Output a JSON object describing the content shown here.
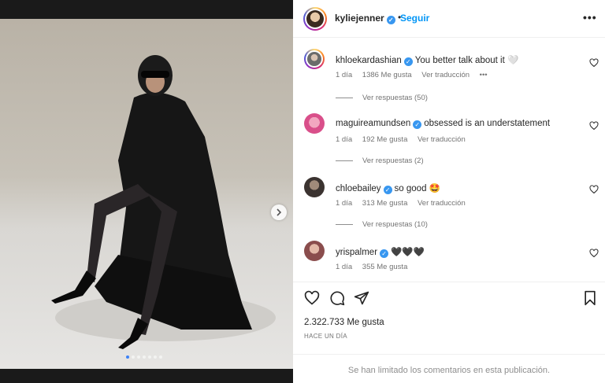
{
  "post": {
    "username": "kyliejenner",
    "follow_label": "Seguir",
    "separator": "•",
    "more_label": "•••",
    "carousel_count": 7,
    "carousel_index": 0
  },
  "comments": [
    {
      "user": "khloekardashian",
      "text": "You better talk about it 🤍",
      "time": "1 día",
      "likes": "1386 Me gusta",
      "translate": "Ver traducción",
      "extra": "•••",
      "replies": "Ver respuestas (50)"
    },
    {
      "user": "maguireamundsen",
      "text": "obsessed is an understatement",
      "time": "1 día",
      "likes": "192 Me gusta",
      "translate": "Ver traducción",
      "replies": "Ver respuestas (2)"
    },
    {
      "user": "chloebailey",
      "text": "so good 🤩",
      "time": "1 día",
      "likes": "313 Me gusta",
      "translate": "Ver traducción",
      "replies": "Ver respuestas (10)"
    },
    {
      "user": "yrispalmer",
      "text": "🖤🖤🖤",
      "time": "1 día",
      "likes": "355 Me gusta"
    }
  ],
  "stats": {
    "likes": "2.322.733 Me gusta",
    "date": "HACE UN DÍA"
  },
  "footer": {
    "limited": "Se han limitado los comentarios en esta publicación."
  },
  "colors": {
    "accent": "#0095f6",
    "verified": "#3897f0",
    "muted": "#737373"
  },
  "icons": [
    "heart-icon",
    "comment-icon",
    "share-icon",
    "bookmark-icon",
    "chevron-right-icon",
    "more-icon",
    "verified-icon"
  ]
}
